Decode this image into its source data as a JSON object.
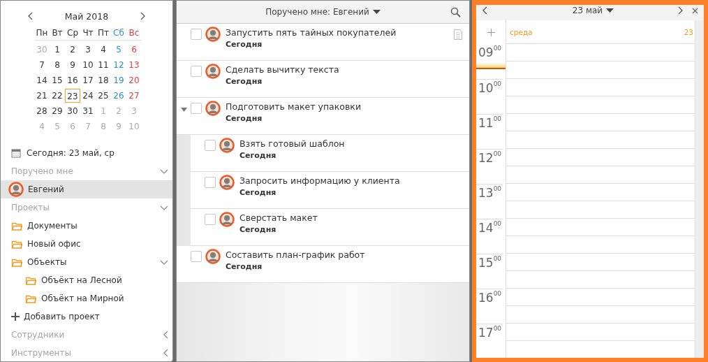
{
  "mini_calendar": {
    "title": "Май 2018",
    "weekdays": [
      {
        "text": "Пн",
        "kind": "weekday"
      },
      {
        "text": "Вт",
        "kind": "weekday"
      },
      {
        "text": "Ср",
        "kind": "weekday"
      },
      {
        "text": "Чт",
        "kind": "weekday"
      },
      {
        "text": "Пт",
        "kind": "weekday"
      },
      {
        "text": "Сб",
        "kind": "saturday"
      },
      {
        "text": "Вс",
        "kind": "sunday"
      }
    ],
    "weeks": [
      [
        {
          "text": "30",
          "muted": true,
          "selected": false
        },
        {
          "text": "1",
          "muted": false,
          "selected": false
        },
        {
          "text": "2",
          "muted": false,
          "selected": false
        },
        {
          "text": "3",
          "muted": false,
          "selected": false
        },
        {
          "text": "4",
          "muted": false,
          "selected": false
        },
        {
          "text": "5",
          "muted": false,
          "selected": false
        },
        {
          "text": "6",
          "muted": false,
          "selected": false
        }
      ],
      [
        {
          "text": "7",
          "muted": false,
          "selected": false
        },
        {
          "text": "8",
          "muted": false,
          "selected": false
        },
        {
          "text": "9",
          "muted": false,
          "selected": false
        },
        {
          "text": "10",
          "muted": false,
          "selected": false
        },
        {
          "text": "11",
          "muted": false,
          "selected": false
        },
        {
          "text": "12",
          "muted": false,
          "selected": false
        },
        {
          "text": "13",
          "muted": false,
          "selected": false
        }
      ],
      [
        {
          "text": "14",
          "muted": false,
          "selected": false
        },
        {
          "text": "15",
          "muted": false,
          "selected": false
        },
        {
          "text": "16",
          "muted": false,
          "selected": false
        },
        {
          "text": "17",
          "muted": false,
          "selected": false
        },
        {
          "text": "18",
          "muted": false,
          "selected": false
        },
        {
          "text": "19",
          "muted": false,
          "selected": false
        },
        {
          "text": "20",
          "muted": false,
          "selected": false
        }
      ],
      [
        {
          "text": "21",
          "muted": false,
          "selected": false
        },
        {
          "text": "22",
          "muted": false,
          "selected": false
        },
        {
          "text": "23",
          "muted": false,
          "selected": true
        },
        {
          "text": "24",
          "muted": false,
          "selected": false
        },
        {
          "text": "25",
          "muted": false,
          "selected": false
        },
        {
          "text": "26",
          "muted": false,
          "selected": false
        },
        {
          "text": "27",
          "muted": false,
          "selected": false
        }
      ],
      [
        {
          "text": "28",
          "muted": false,
          "selected": false
        },
        {
          "text": "29",
          "muted": false,
          "selected": false
        },
        {
          "text": "30",
          "muted": false,
          "selected": false
        },
        {
          "text": "31",
          "muted": false,
          "selected": false
        },
        {
          "text": "1",
          "muted": true,
          "selected": false
        },
        {
          "text": "2",
          "muted": true,
          "selected": false
        },
        {
          "text": "3",
          "muted": true,
          "selected": false
        }
      ],
      [
        {
          "text": "4",
          "muted": true,
          "selected": false
        },
        {
          "text": "5",
          "muted": true,
          "selected": false
        },
        {
          "text": "6",
          "muted": true,
          "selected": false
        },
        {
          "text": "7",
          "muted": true,
          "selected": false
        },
        {
          "text": "8",
          "muted": true,
          "selected": false
        },
        {
          "text": "9",
          "muted": true,
          "selected": false
        },
        {
          "text": "10",
          "muted": true,
          "selected": false
        }
      ]
    ]
  },
  "today_label": "Сегодня: 23 май, ср",
  "sidebar": [
    {
      "title": "Поручено мне",
      "expanded": true,
      "items": [
        {
          "kind": "person",
          "label": "Евгений",
          "selected": true
        }
      ]
    },
    {
      "title": "Проекты",
      "expanded": true,
      "items": [
        {
          "kind": "folder",
          "label": "Документы",
          "selected": false
        },
        {
          "kind": "folder",
          "label": "Новый офис",
          "selected": false
        },
        {
          "kind": "folder",
          "label": "Объекты",
          "selected": false,
          "expanded": true,
          "children": [
            {
              "kind": "folder",
              "label": "Объёкт на Лесной",
              "selected": false
            },
            {
              "kind": "folder",
              "label": "Объёкт на Мирной",
              "selected": false
            }
          ]
        },
        {
          "kind": "add",
          "label": "Добавить проект",
          "selected": false
        }
      ]
    },
    {
      "title": "Сотрудники",
      "expanded": false
    },
    {
      "title": "Инструменты",
      "expanded": false
    }
  ],
  "tasks_header": "Поручено мне: Евгений",
  "tasks": [
    {
      "title": "Запустить пять тайных покупателей",
      "due": "Сегодня",
      "checked": false,
      "has_note": true
    },
    {
      "title": "Сделать вычитку текста",
      "due": "Сегодня",
      "checked": false,
      "has_note": false
    },
    {
      "title": "Подготовить макет упаковки",
      "due": "Сегодня",
      "checked": false,
      "has_note": false,
      "expanded": true,
      "children": [
        {
          "title": "Взять готовый шаблон",
          "due": "Сегодня",
          "checked": false,
          "has_note": false
        },
        {
          "title": "Запросить информацию у клиента",
          "due": "Сегодня",
          "checked": false,
          "has_note": false
        },
        {
          "title": "Сверстать макет",
          "due": "Сегодня",
          "checked": false,
          "has_note": false
        }
      ]
    },
    {
      "title": "Составить план-график работ",
      "due": "Сегодня",
      "checked": false,
      "has_note": false
    }
  ],
  "day_view": {
    "title": "23 май",
    "weekday": "среда",
    "day_number": "23",
    "hours": [
      "09$^{00}$",
      "10$^{00}$",
      "11$^{00}$",
      "12$^{00}$",
      "13$^{00}$",
      "14$^{00}$",
      "15$^{00}$",
      "16$^{00}$",
      "17$^{00}$"
    ]
  }
}
